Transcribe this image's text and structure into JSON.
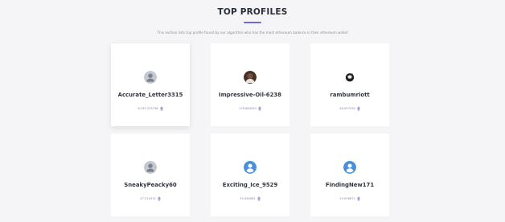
{
  "section": {
    "title": "TOP PROFILES",
    "subtitle": "This section lists top profile found by our algorithm who has the most ethereum balance in their ethereum wallet"
  },
  "profiles": [
    {
      "name": "Accurate_Letter3315",
      "balance": "6,235.223738",
      "avatar": "default-user-icon"
    },
    {
      "name": "Impressive-Oil-6238",
      "balance": "179.684919",
      "avatar": "photo-avatar"
    },
    {
      "name": "rambumriott",
      "balance": "48.097476",
      "avatar": "dark-photo-avatar"
    },
    {
      "name": "SneakyPeacky60",
      "balance": "47.214274",
      "avatar": "default-user-icon"
    },
    {
      "name": "Exciting_Ice_9529",
      "balance": "33.346082",
      "avatar": "blue-user-icon"
    },
    {
      "name": "FindingNew171",
      "balance": "15.056871",
      "avatar": "blue-user-icon"
    }
  ],
  "currency_icon": "ethereum-icon",
  "colors": {
    "accent": "#6d6bd6",
    "card": "#ffffff",
    "background": "#f5f5f7",
    "name": "#2f3542",
    "balance": "#7e7fb8",
    "default_avatar": "#c3c7cf",
    "blue_avatar": "#4a90d9"
  }
}
